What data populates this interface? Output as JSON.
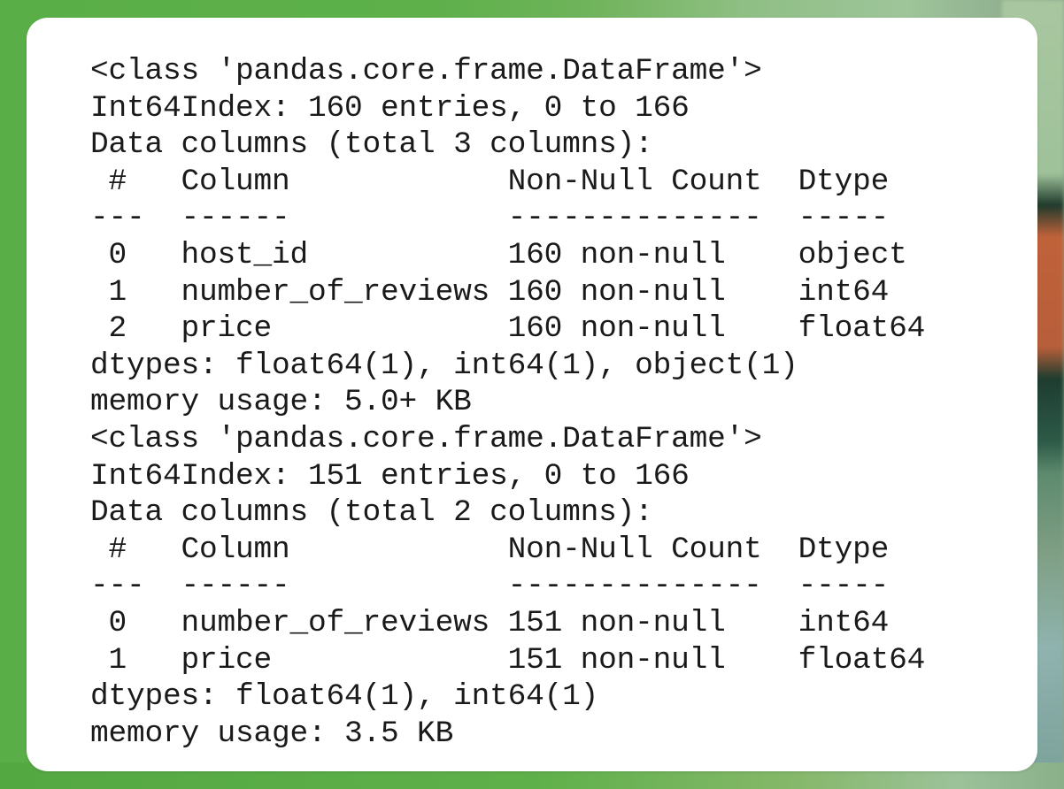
{
  "output_blocks": [
    {
      "class_line": "<class 'pandas.core.frame.DataFrame'>",
      "index_line": "Int64Index: 160 entries, 0 to 166",
      "columns_line": "Data columns (total 3 columns):",
      "header": {
        "num": "#",
        "column": "Column",
        "count": "Non-Null Count",
        "dtype": "Dtype"
      },
      "separator": {
        "num": "---",
        "column": "------",
        "count": "--------------",
        "dtype": "-----"
      },
      "rows": [
        {
          "num": "0",
          "column": "host_id",
          "count": "160 non-null",
          "dtype": "object"
        },
        {
          "num": "1",
          "column": "number_of_reviews",
          "count": "160 non-null",
          "dtype": "int64"
        },
        {
          "num": "2",
          "column": "price",
          "count": "160 non-null",
          "dtype": "float64"
        }
      ],
      "dtypes_line": "dtypes: float64(1), int64(1), object(1)",
      "memory_line": "memory usage: 5.0+ KB"
    },
    {
      "class_line": "<class 'pandas.core.frame.DataFrame'>",
      "index_line": "Int64Index: 151 entries, 0 to 166",
      "columns_line": "Data columns (total 2 columns):",
      "header": {
        "num": "#",
        "column": "Column",
        "count": "Non-Null Count",
        "dtype": "Dtype"
      },
      "separator": {
        "num": "---",
        "column": "------",
        "count": "--------------",
        "dtype": "-----"
      },
      "rows": [
        {
          "num": "0",
          "column": "number_of_reviews",
          "count": "151 non-null",
          "dtype": "int64"
        },
        {
          "num": "1",
          "column": "price",
          "count": "151 non-null",
          "dtype": "float64"
        }
      ],
      "dtypes_line": "dtypes: float64(1), int64(1)",
      "memory_line": "memory usage: 3.5 KB"
    }
  ]
}
